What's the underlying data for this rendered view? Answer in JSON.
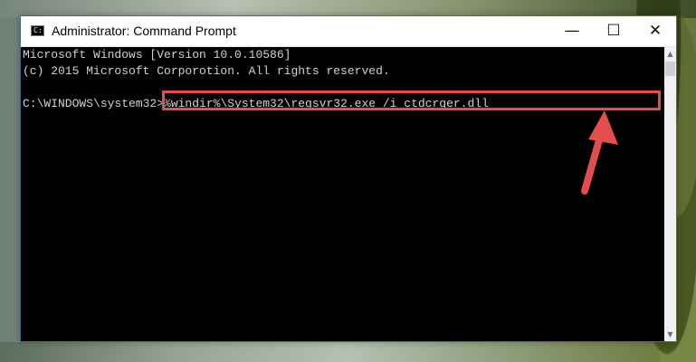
{
  "window": {
    "title": "Administrator: Command Prompt",
    "icon_name": "command-prompt-icon",
    "controls": [
      "minimize",
      "maximize",
      "close"
    ]
  },
  "console": {
    "lines": [
      "Microsoft Windows [Version 10.0.10586]",
      "(c) 2015 Microsoft Corporotion. All rights reserved.",
      ""
    ],
    "prompt": "C:\\WINDOWS\\system32>",
    "command": "%windir%\\System32\\regsvr32.exe /i ctdcrger.dll"
  },
  "annotation": {
    "highlight_color": "#e34d4d",
    "arrow_name": "red-pointer-arrow"
  }
}
